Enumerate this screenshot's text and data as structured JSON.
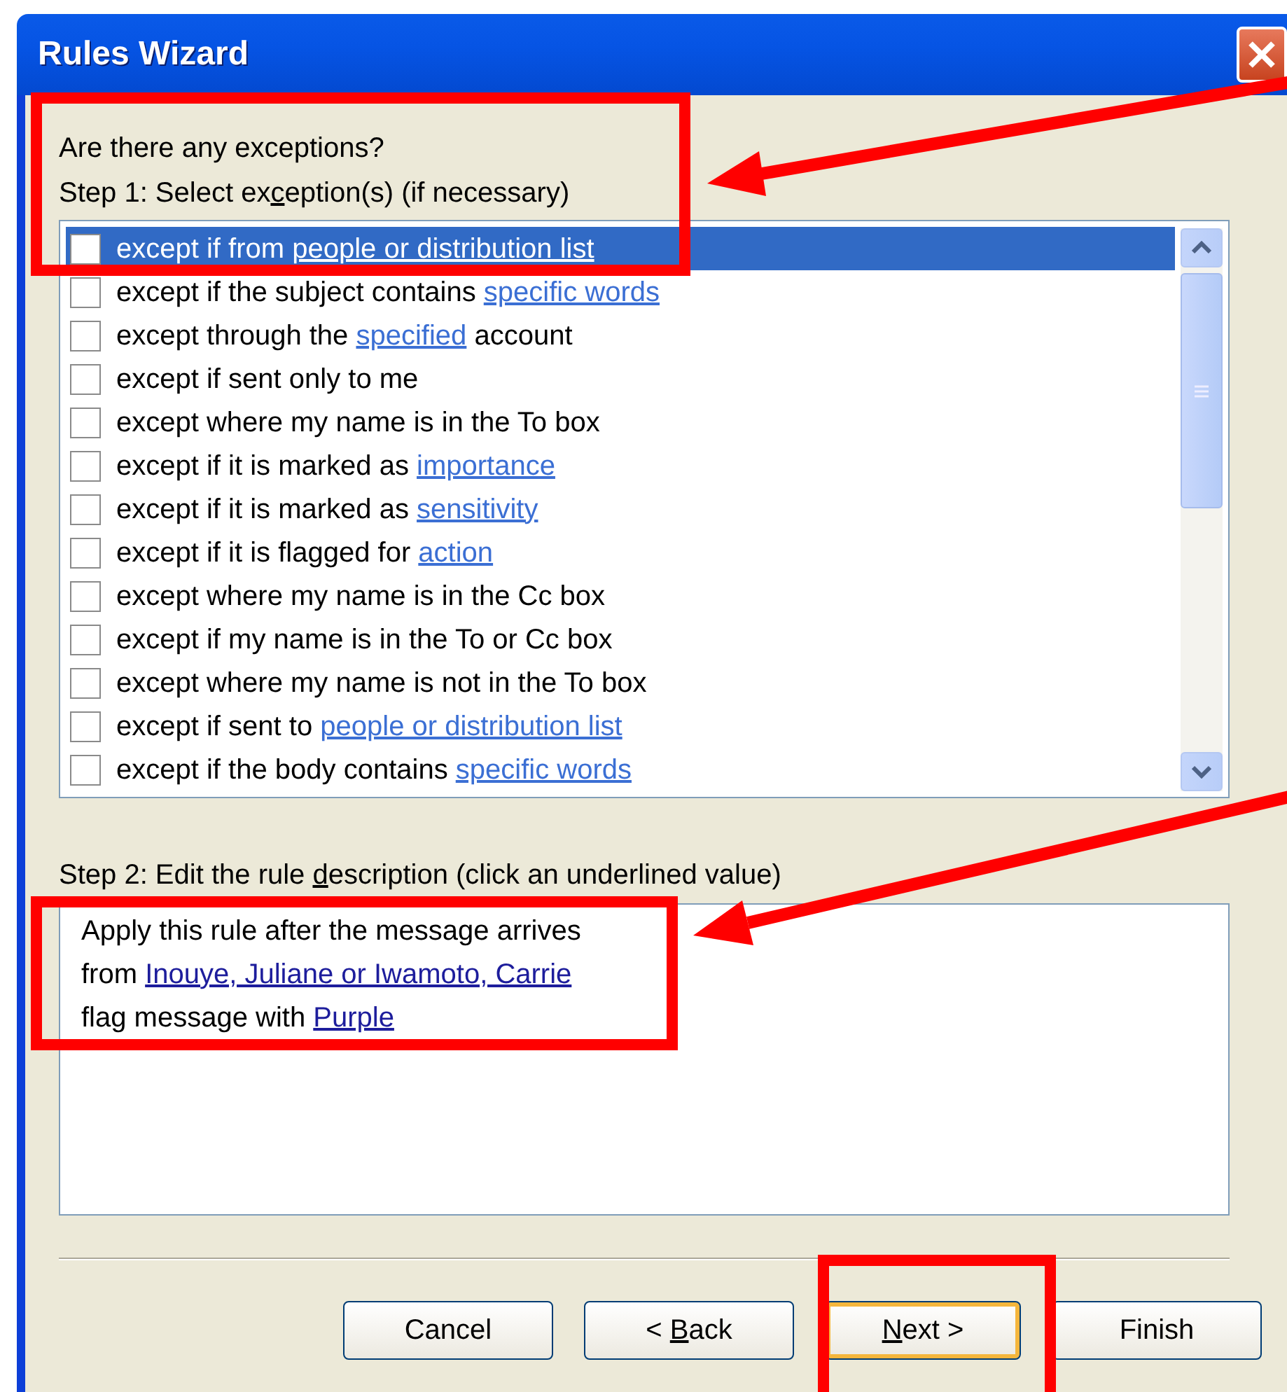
{
  "window": {
    "title": "Rules Wizard"
  },
  "question": "Are there any exceptions?",
  "step1": {
    "label": [
      {
        "kind": "text",
        "text": "Step 1: Select ex"
      },
      {
        "kind": "access_key",
        "text": "c"
      },
      {
        "kind": "text",
        "text": "eption(s) (if necessary)"
      }
    ]
  },
  "exceptions": [
    {
      "selected": true,
      "checked": false,
      "segments": [
        {
          "kind": "text",
          "text": "except if from "
        },
        {
          "kind": "link",
          "text": "people or distribution list"
        }
      ]
    },
    {
      "selected": false,
      "checked": false,
      "segments": [
        {
          "kind": "text",
          "text": "except if the subject contains "
        },
        {
          "kind": "link",
          "text": "specific words"
        }
      ]
    },
    {
      "selected": false,
      "checked": false,
      "segments": [
        {
          "kind": "text",
          "text": "except through the "
        },
        {
          "kind": "link",
          "text": "specified"
        },
        {
          "kind": "text",
          "text": " account"
        }
      ]
    },
    {
      "selected": false,
      "checked": false,
      "segments": [
        {
          "kind": "text",
          "text": "except if sent only to me"
        }
      ]
    },
    {
      "selected": false,
      "checked": false,
      "segments": [
        {
          "kind": "text",
          "text": "except where my name is in the To box"
        }
      ]
    },
    {
      "selected": false,
      "checked": false,
      "segments": [
        {
          "kind": "text",
          "text": "except if it is marked as "
        },
        {
          "kind": "link",
          "text": "importance"
        }
      ]
    },
    {
      "selected": false,
      "checked": false,
      "segments": [
        {
          "kind": "text",
          "text": "except if it is marked as "
        },
        {
          "kind": "link",
          "text": "sensitivity"
        }
      ]
    },
    {
      "selected": false,
      "checked": false,
      "segments": [
        {
          "kind": "text",
          "text": "except if it is flagged for "
        },
        {
          "kind": "link",
          "text": "action"
        }
      ]
    },
    {
      "selected": false,
      "checked": false,
      "segments": [
        {
          "kind": "text",
          "text": "except where my name is in the Cc box"
        }
      ]
    },
    {
      "selected": false,
      "checked": false,
      "segments": [
        {
          "kind": "text",
          "text": "except if my name is in the To or Cc box"
        }
      ]
    },
    {
      "selected": false,
      "checked": false,
      "segments": [
        {
          "kind": "text",
          "text": "except where my name is not in the To box"
        }
      ]
    },
    {
      "selected": false,
      "checked": false,
      "segments": [
        {
          "kind": "text",
          "text": "except if sent to "
        },
        {
          "kind": "link",
          "text": "people or distribution list"
        }
      ]
    },
    {
      "selected": false,
      "checked": false,
      "segments": [
        {
          "kind": "text",
          "text": "except if the body contains "
        },
        {
          "kind": "link",
          "text": "specific words"
        }
      ]
    }
  ],
  "step2": {
    "label": [
      {
        "kind": "text",
        "text": "Step 2: Edit the rule "
      },
      {
        "kind": "access_key",
        "text": "d"
      },
      {
        "kind": "text",
        "text": "escription (click an underlined value)"
      }
    ]
  },
  "description": [
    [
      {
        "kind": "text",
        "text": "Apply this rule after the message arrives"
      }
    ],
    [
      {
        "kind": "text",
        "text": "from "
      },
      {
        "kind": "link",
        "text": "Inouye, Juliane or Iwamoto, Carrie"
      }
    ],
    [
      {
        "kind": "text",
        "text": "flag message with "
      },
      {
        "kind": "link",
        "text": "Purple"
      }
    ]
  ],
  "buttons": [
    {
      "label": [
        {
          "kind": "text",
          "text": "Cancel"
        }
      ],
      "focused": false
    },
    {
      "label": [
        {
          "kind": "text",
          "text": "< "
        },
        {
          "kind": "access_key",
          "text": "B"
        },
        {
          "kind": "text",
          "text": "ack"
        }
      ],
      "focused": false
    },
    {
      "label": [
        {
          "kind": "access_key",
          "text": "N"
        },
        {
          "kind": "text",
          "text": "ext >"
        }
      ],
      "focused": true
    },
    {
      "label": [
        {
          "kind": "text",
          "text": "Finish"
        }
      ],
      "focused": false
    }
  ],
  "annotations": [
    {
      "kind": "box"
    },
    {
      "kind": "arrow"
    },
    {
      "kind": "box"
    },
    {
      "kind": "arrow"
    },
    {
      "kind": "box"
    }
  ]
}
